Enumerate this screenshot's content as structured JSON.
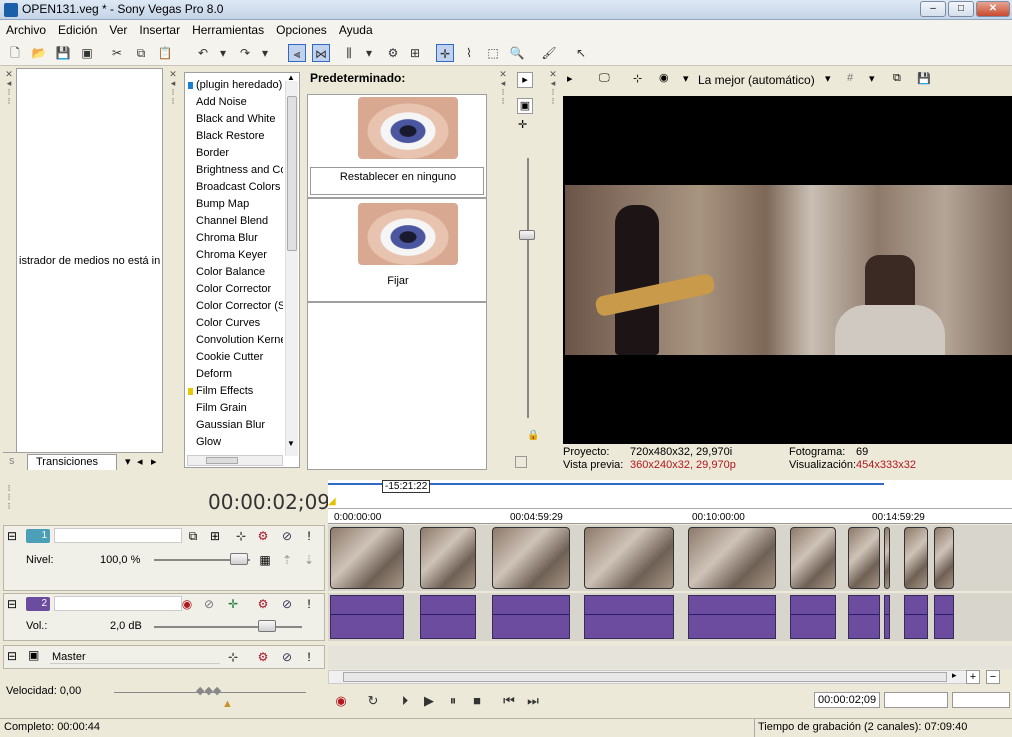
{
  "window": {
    "title": "OPEN131.veg * - Sony Vegas Pro 8.0"
  },
  "menu": [
    "Archivo",
    "Edición",
    "Ver",
    "Insertar",
    "Herramientas",
    "Opciones",
    "Ayuda"
  ],
  "media_explorer": {
    "message": "istrador de medios no está in",
    "tab_label": "Transiciones"
  },
  "fx_list": {
    "items": [
      "(plugin heredado)",
      "Add Noise",
      "Black and White",
      "Black Restore",
      "Border",
      "Brightness and Co",
      "Broadcast Colors",
      "Bump Map",
      "Channel Blend",
      "Chroma Blur",
      "Chroma Keyer",
      "Color Balance",
      "Color Corrector",
      "Color Corrector (S",
      "Color Curves",
      "Convolution Kerne",
      "Cookie Cutter",
      "Deform",
      "Film Effects",
      "Film Grain",
      "Gaussian Blur",
      "Glow"
    ]
  },
  "presets": {
    "title": "Predeterminado:",
    "items": [
      {
        "label": "Restablecer en ninguno"
      },
      {
        "label": "Fijar"
      }
    ]
  },
  "preview": {
    "quality": "La mejor (automático)",
    "proyecto_label": "Proyecto:",
    "proyecto_value": "720x480x32, 29,970i",
    "vista_label": "Vista previa:",
    "vista_value": "360x240x32, 29,970p",
    "fotograma_label": "Fotograma:",
    "fotograma_value": "69",
    "visualizacion_label": "Visualización:",
    "visualizacion_value": "454x333x32"
  },
  "timeline": {
    "timecode": "00:00:02;09",
    "region_marker": "-15:21:22",
    "ruler_labels": [
      "0:00:00:00",
      "00:04:59:29",
      "00:10:00:00",
      "00:14:59:29"
    ],
    "track1": {
      "number": "1",
      "param_label": "Nivel:",
      "param_value": "100,0 %"
    },
    "track2": {
      "number": "2",
      "param_label": "Vol.:",
      "param_value": "2,0 dB"
    },
    "master": {
      "label": "Master"
    }
  },
  "velocity": {
    "label": "Velocidad: 0,00"
  },
  "transport": {
    "timecode": "00:00:02;09"
  },
  "status": {
    "left": "Completo: 00:00:44",
    "right": "Tiempo de grabación (2 canales): 07:09:40"
  }
}
